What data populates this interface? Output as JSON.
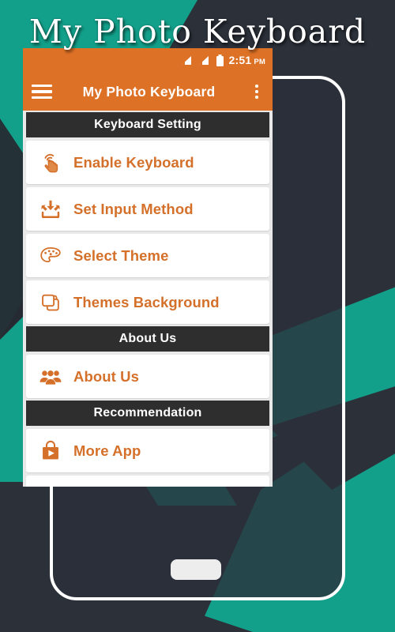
{
  "headline": "My Photo Keyboard",
  "colors": {
    "accent_orange": "#dd7126",
    "text_orange": "#d4702a",
    "teal": "#12a08a",
    "dark_navy": "#2b3039",
    "section_dark": "#2e2e2e",
    "card_white": "#ffffff"
  },
  "statusbar": {
    "time": "2:51",
    "ampm": "PM",
    "signal_1": "signal-bars-icon",
    "signal_2": "signal-bars-icon",
    "battery": "battery-icon"
  },
  "appbar": {
    "menu_icon": "hamburger-menu-icon",
    "title": "My Photo Keyboard",
    "overflow_icon": "kebab-menu-icon"
  },
  "sections": [
    {
      "header": "Keyboard Setting",
      "items": [
        {
          "label": "Enable Keyboard",
          "icon": "touch-tap-hand-icon"
        },
        {
          "label": "Set Input Method",
          "icon": "arrows-into-tray-icon"
        },
        {
          "label": "Select Theme",
          "icon": "paint-palette-icon"
        },
        {
          "label": "Themes Background",
          "icon": "overlapping-squares-icon"
        }
      ]
    },
    {
      "header": "About Us",
      "items": [
        {
          "label": "About Us",
          "icon": "people-group-icon"
        }
      ]
    },
    {
      "header": "Recommendation",
      "items": [
        {
          "label": "More App",
          "icon": "store-bag-play-icon"
        }
      ]
    }
  ]
}
